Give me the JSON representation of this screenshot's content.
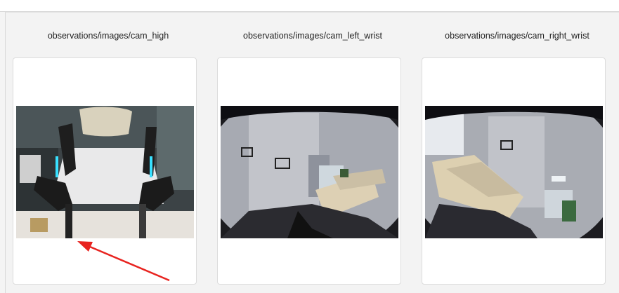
{
  "header": {
    "title": ""
  },
  "cameras": [
    {
      "title": "observations/images/cam_high"
    },
    {
      "title": "observations/images/cam_left_wrist"
    },
    {
      "title": "observations/images/cam_right_wrist"
    }
  ],
  "annotation": {
    "arrow_color": "#e8231f"
  }
}
